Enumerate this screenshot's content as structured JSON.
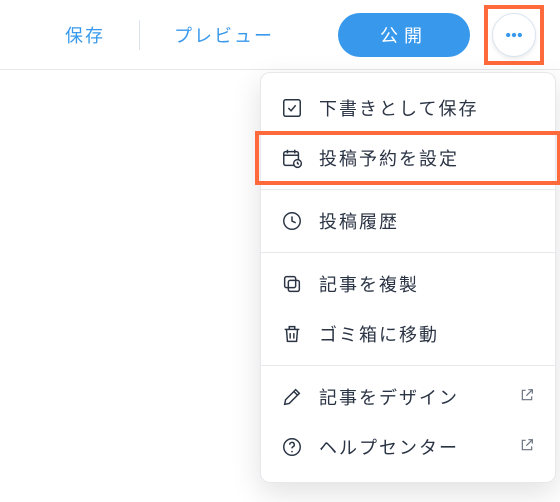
{
  "toolbar": {
    "save_label": "保存",
    "preview_label": "プレビュー",
    "publish_label": "公開"
  },
  "menu": {
    "save_draft": "下書きとして保存",
    "schedule": "投稿予約を設定",
    "history": "投稿履歴",
    "duplicate": "記事を複製",
    "trash": "ゴミ箱に移動",
    "design": "記事をデザイン",
    "help": "ヘルプセンター"
  },
  "colors": {
    "accent": "#3899ec",
    "highlight": "#ff6a3c"
  }
}
